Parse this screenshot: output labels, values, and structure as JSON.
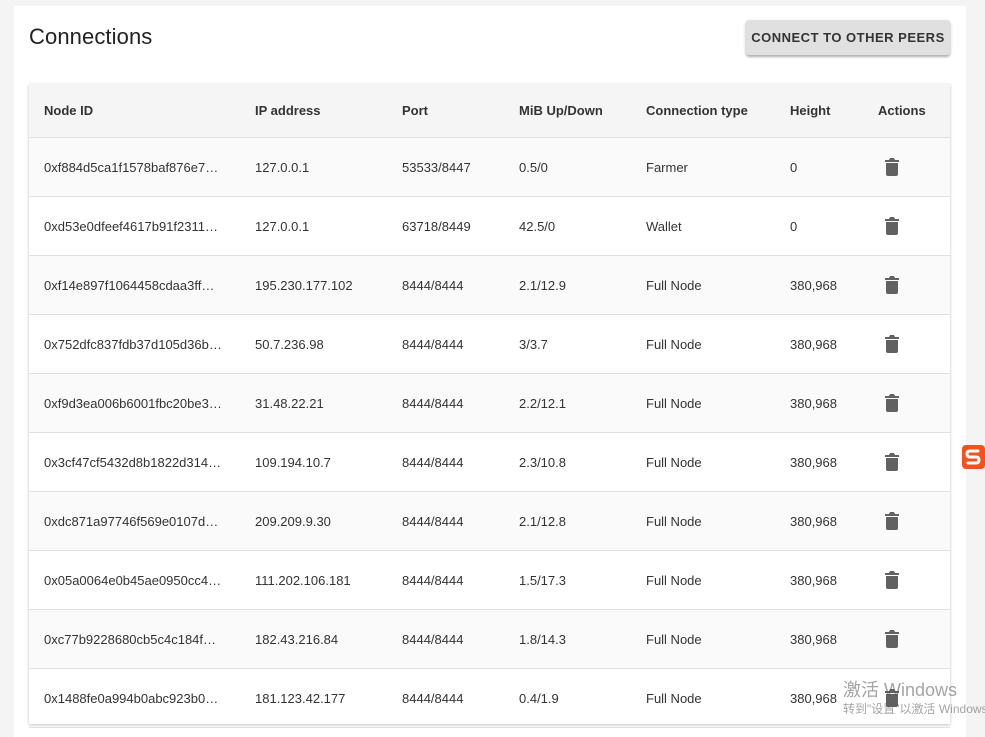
{
  "page": {
    "title": "Connections",
    "connect_button_label": "CONNECT TO OTHER PEERS"
  },
  "table": {
    "headers": [
      "Node ID",
      "IP address",
      "Port",
      "MiB Up/Down",
      "Connection type",
      "Height",
      "Actions"
    ],
    "rows": [
      [
        "0xf884d5ca1f1578baf876e7…",
        "127.0.0.1",
        "53533/8447",
        "0.5/0",
        "Farmer",
        "0"
      ],
      [
        "0xd53e0dfeef4617b91f2311…",
        "127.0.0.1",
        "63718/8449",
        "42.5/0",
        "Wallet",
        "0"
      ],
      [
        "0xf14e897f1064458cdaa3ff…",
        "195.230.177.102",
        "8444/8444",
        "2.1/12.9",
        "Full Node",
        "380,968"
      ],
      [
        "0x752dfc837fdb37d105d36b…",
        "50.7.236.98",
        "8444/8444",
        "3/3.7",
        "Full Node",
        "380,968"
      ],
      [
        "0xf9d3ea006b6001fbc20be3…",
        "31.48.22.21",
        "8444/8444",
        "2.2/12.1",
        "Full Node",
        "380,968"
      ],
      [
        "0x3cf47cf5432d8b1822d314…",
        "109.194.10.7",
        "8444/8444",
        "2.3/10.8",
        "Full Node",
        "380,968"
      ],
      [
        "0xdc871a97746f569e0107d…",
        "209.209.9.30",
        "8444/8444",
        "2.1/12.8",
        "Full Node",
        "380,968"
      ],
      [
        "0x05a0064e0b45ae0950cc4…",
        "111.202.106.181",
        "8444/8444",
        "1.5/17.3",
        "Full Node",
        "380,968"
      ],
      [
        "0xc77b9228680cb5c4c184f…",
        "182.43.216.84",
        "8444/8444",
        "1.8/14.3",
        "Full Node",
        "380,968"
      ],
      [
        "0x1488fe0a994b0abc923b0…",
        "181.123.42.177",
        "8444/8444",
        "0.4/1.9",
        "Full Node",
        "380,968"
      ]
    ],
    "action_icon": "delete-icon"
  },
  "overlay": {
    "watermark_line1": "激活 Windows",
    "watermark_line2": "转到\"设置\"以激活 Windows。",
    "tray_icon": "sogou-ime-icon"
  },
  "colors": {
    "button_bg": "#e0e0e0",
    "header_bg": "#f5f5f5",
    "ime_orange": "#f4511e"
  }
}
